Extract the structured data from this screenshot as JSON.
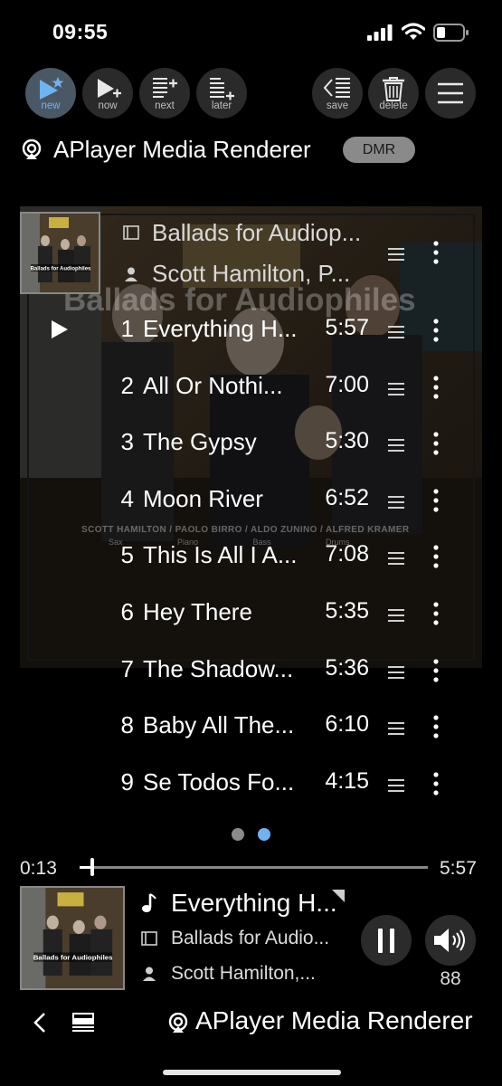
{
  "status": {
    "time": "09:55"
  },
  "toolbar": {
    "new": "new",
    "now": "now",
    "next": "next",
    "later": "later",
    "save": "save",
    "delete": "delete"
  },
  "renderer": {
    "name": "APlayer Media Renderer",
    "badge": "DMR"
  },
  "album_art": {
    "title": "Ballads for Audiophiles",
    "members": "SCOTT HAMILTON  /  PAOLO BIRRO  /  ALDO ZUNINO  /  ALFRED KRAMER",
    "instruments": "Sax Piano Bass Drums"
  },
  "album": {
    "title": "Ballads for Audiop...",
    "artist": "Scott Hamilton, P..."
  },
  "tracks": [
    {
      "num": "1",
      "title": "Everything H...",
      "duration": "5:57",
      "playing": true
    },
    {
      "num": "2",
      "title": "All Or Nothi...",
      "duration": "7:00"
    },
    {
      "num": "3",
      "title": "The Gypsy",
      "duration": "5:30"
    },
    {
      "num": "4",
      "title": "Moon River",
      "duration": "6:52"
    },
    {
      "num": "5",
      "title": "This Is All I A...",
      "duration": "7:08"
    },
    {
      "num": "6",
      "title": "Hey There",
      "duration": "5:35"
    },
    {
      "num": "7",
      "title": "The Shadow...",
      "duration": "5:36"
    },
    {
      "num": "8",
      "title": "Baby All The...",
      "duration": "6:10"
    },
    {
      "num": "9",
      "title": "Se Todos Fo...",
      "duration": "4:15"
    }
  ],
  "pager": {
    "pages": 2,
    "current": 2
  },
  "progress": {
    "position": "0:13",
    "duration": "5:57",
    "fraction": 0.036
  },
  "now_playing": {
    "title": "Everything H...",
    "album": "Ballads for Audio...",
    "artist": "Scott Hamilton,..."
  },
  "volume": {
    "value": "88"
  },
  "bottom": {
    "renderer": "APlayer Media Renderer"
  },
  "colors": {
    "accent": "#6fb4f0",
    "active_button": "#4a5866",
    "button": "#2a2a2a",
    "badge": "#8a8a8a"
  }
}
